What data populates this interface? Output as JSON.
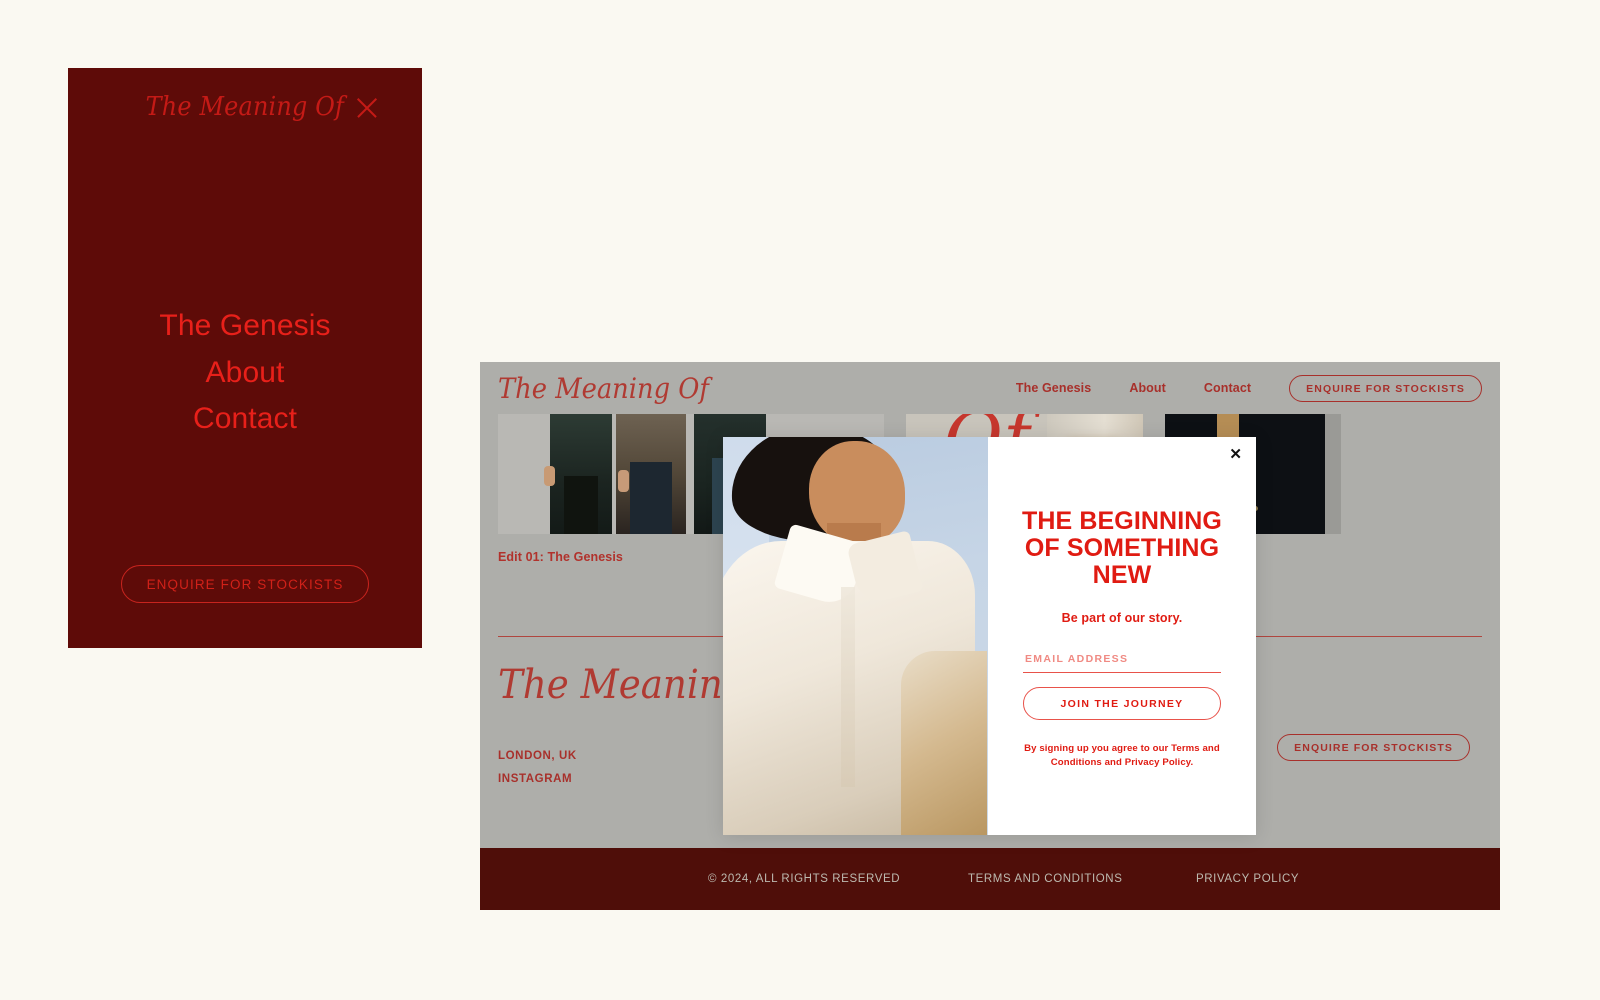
{
  "brand": {
    "name": "The Meaning Of",
    "accent_red": "#e01b12",
    "muted_red": "#a8302b",
    "dark_maroon": "#5e0b08",
    "footer_maroon": "#4f0e09",
    "page_bg": "#faf9f2",
    "site_bg": "#aeaeaa"
  },
  "menu_panel": {
    "logo": "The Meaning Of",
    "close_label": "Close menu",
    "links": [
      {
        "label": "The Genesis"
      },
      {
        "label": "About"
      },
      {
        "label": "Contact"
      }
    ],
    "cta": "ENQUIRE FOR STOCKISTS"
  },
  "site": {
    "logo": "The Meaning Of",
    "nav": [
      {
        "label": "The Genesis"
      },
      {
        "label": "About"
      },
      {
        "label": "Contact"
      }
    ],
    "nav_cta": "ENQUIRE FOR STOCKISTS",
    "hero_caption": "Edit 01: The Genesis",
    "mid_logo": "The Meaning Of",
    "mid_links": [
      {
        "label": "LONDON, UK"
      },
      {
        "label": "INSTAGRAM"
      }
    ],
    "mid_cta": "ENQUIRE FOR STOCKISTS",
    "hero_script_mark": "Of",
    "footer": {
      "copyright": "© 2024, ALL RIGHTS RESERVED",
      "terms": "TERMS AND CONDITIONS",
      "privacy": "PRIVACY POLICY"
    }
  },
  "modal": {
    "close_glyph": "✕",
    "title": "THE BEGINNING OF SOMETHING NEW",
    "subtitle": "Be part of our story.",
    "email_placeholder": "EMAIL ADDRESS",
    "email_value": "",
    "submit_label": "JOIN THE JOURNEY",
    "fine_print": "By signing up you agree to our Terms and Conditions and Privacy Policy."
  }
}
